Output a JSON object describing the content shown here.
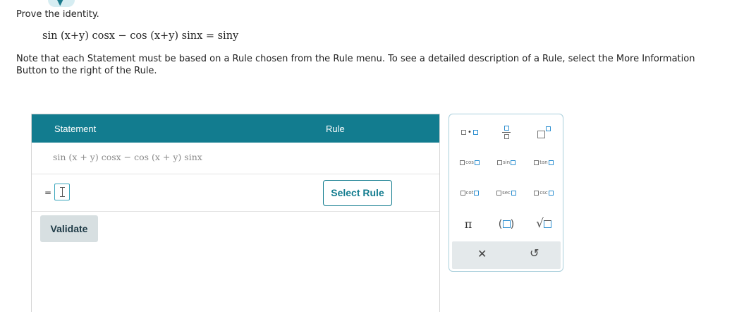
{
  "header": {
    "prompt": "Prove the identity.",
    "identity": "sin (x+y) cosx − cos (x+y) sinx = siny",
    "note": "Note that each Statement must be based on a Rule chosen from the Rule menu. To see a detailed description of a Rule, select the More Information Button to the right of the Rule."
  },
  "proof": {
    "statement_header": "Statement",
    "rule_header": "Rule",
    "first_statement": "sin (x + y) cosx − cos (x + y) sinx",
    "equals": "=",
    "select_rule_label": "Select Rule",
    "validate_label": "Validate"
  },
  "palette": {
    "multiply_dot": "•",
    "cos": "cos",
    "sin": "sin",
    "tan": "tan",
    "cot": "cot",
    "sec": "sec",
    "csc": "csc",
    "pi": "π",
    "paren_open": "(",
    "paren_close": ")",
    "sqrt": "√",
    "clear": "✕",
    "undo": "↺"
  },
  "colors": {
    "header_bg": "#127c8f",
    "accent": "#127c8f",
    "validate_bg": "#d7dfe1"
  }
}
